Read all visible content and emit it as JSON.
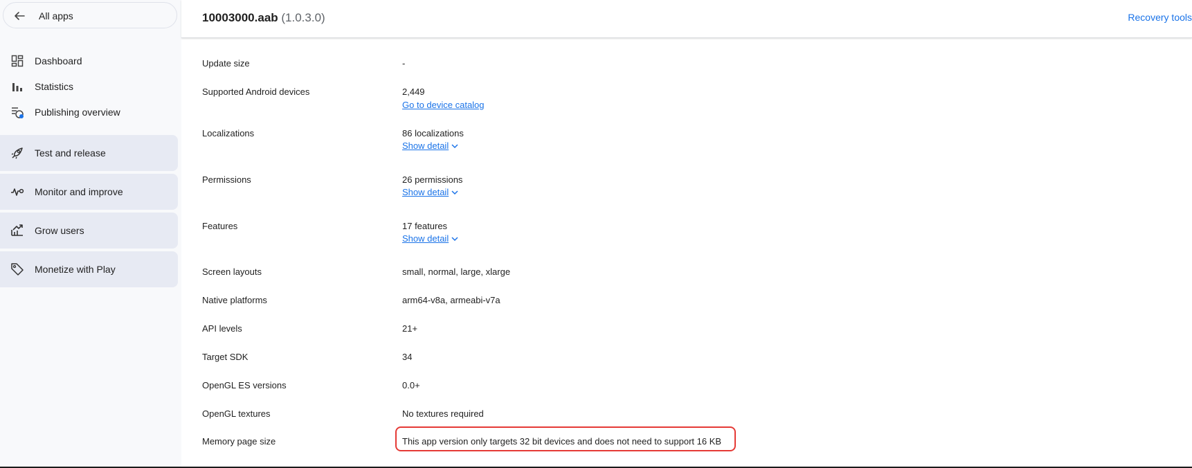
{
  "sidebar": {
    "back_label": "All apps",
    "items": [
      {
        "label": "Dashboard",
        "icon": "dashboard-icon"
      },
      {
        "label": "Statistics",
        "icon": "bar-chart-icon"
      },
      {
        "label": "Publishing overview",
        "icon": "publishing-overview-icon"
      }
    ],
    "sections": [
      {
        "label": "Test and release",
        "icon": "rocket-icon"
      },
      {
        "label": "Monitor and improve",
        "icon": "vitals-icon"
      },
      {
        "label": "Grow users",
        "icon": "grow-icon"
      },
      {
        "label": "Monetize with Play",
        "icon": "tag-icon"
      }
    ]
  },
  "header": {
    "title": "10003000.aab",
    "version": "(1.0.3.0)",
    "recovery_tools": "Recovery tools"
  },
  "details": {
    "update_size": {
      "label": "Update size",
      "value": "-"
    },
    "devices": {
      "label": "Supported Android devices",
      "value": "2,449",
      "link": "Go to device catalog"
    },
    "localizations": {
      "label": "Localizations",
      "value": "86 localizations",
      "link": "Show detail"
    },
    "permissions": {
      "label": "Permissions",
      "value": "26 permissions",
      "link": "Show detail"
    },
    "features": {
      "label": "Features",
      "value": "17 features",
      "link": "Show detail"
    },
    "screen_layouts": {
      "label": "Screen layouts",
      "value": "small, normal, large, xlarge"
    },
    "native_platforms": {
      "label": "Native platforms",
      "value": "arm64-v8a, armeabi-v7a"
    },
    "api_levels": {
      "label": "API levels",
      "value": "21+"
    },
    "target_sdk": {
      "label": "Target SDK",
      "value": "34"
    },
    "opengl_es": {
      "label": "OpenGL ES versions",
      "value": "0.0+"
    },
    "opengl_textures": {
      "label": "OpenGL textures",
      "value": "No textures required"
    },
    "memory_page_size": {
      "label": "Memory page size",
      "value": "This app version only targets 32 bit devices and does not need to support 16 KB"
    }
  },
  "colors": {
    "link": "#1a73e8",
    "highlight_border": "#e53935",
    "section_bg": "#e7eaf3",
    "sidebar_bg": "#f8f9fb"
  }
}
